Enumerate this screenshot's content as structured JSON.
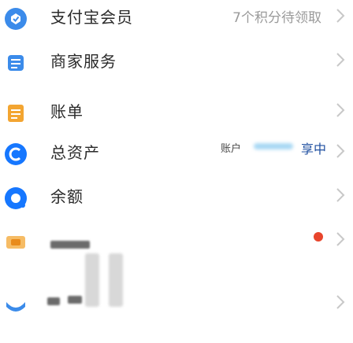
{
  "rows": [
    {
      "label": "支付宝会员",
      "value": "7个积分待领取",
      "icon": "shield-check-icon",
      "color": "#3b8bea"
    },
    {
      "label": "商家服务",
      "value": "",
      "icon": "service-icon",
      "color": "#3b8bea"
    },
    {
      "label": "账单",
      "value": "",
      "icon": "bill-icon",
      "color": "#f3a531"
    },
    {
      "label": "总资产",
      "value": "",
      "icon": "asset-icon",
      "color": "#1677ff",
      "badge_left": "账户",
      "badge_right": "享中"
    },
    {
      "label": "余额",
      "value": "",
      "icon": "balance-icon",
      "color": "#1677ff"
    },
    {
      "label": "",
      "value": "",
      "icon": "yuebao-icon",
      "color": "#f3a531",
      "red_dot": true
    },
    {
      "label": "",
      "value": "",
      "icon": "yue-icon",
      "color": "#3b8bea"
    }
  ],
  "left_icons": [
    {
      "icon": "card-icon",
      "color": "#1677ff"
    },
    {
      "icon": "gift-icon",
      "color": "#f36b3a"
    },
    {
      "icon": "coupon-icon",
      "color": "#1677ff"
    },
    {
      "icon": "chat-icon",
      "color": "#1677ff"
    },
    {
      "icon": "list-icon",
      "color": "#f3a531"
    },
    {
      "icon": "score-icon",
      "color": "#3b8bea"
    },
    {
      "icon": "gear-icon",
      "color": "#3b8bea"
    }
  ],
  "chevron": "›"
}
